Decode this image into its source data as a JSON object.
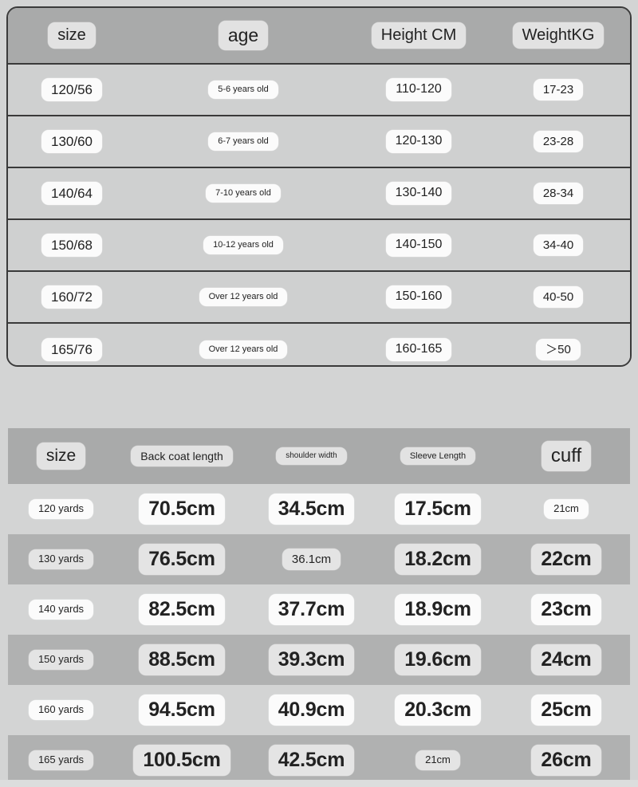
{
  "colors": {
    "page_background": "#d3d4d4",
    "header_bar": "#a9aaaa",
    "table_one_body": "#cfd0d0",
    "table_one_border": "#3a3a3a",
    "stripe_row": "#b0b1b1",
    "chip_light": "#fbfbfb",
    "chip_header": "#e2e2e2",
    "text": "#1e1e1e"
  },
  "size_table": {
    "headers": [
      "size",
      "age",
      "Height CM",
      "WeightKG"
    ],
    "rows": [
      {
        "size": "120/56",
        "age": "5-6 years old",
        "height": "110-120",
        "weight": "17-23"
      },
      {
        "size": "130/60",
        "age": "6-7 years old",
        "height": "120-130",
        "weight": "23-28"
      },
      {
        "size": "140/64",
        "age": "7-10 years old",
        "height": "130-140",
        "weight": "28-34"
      },
      {
        "size": "150/68",
        "age": "10-12 years old",
        "height": "140-150",
        "weight": "34-40"
      },
      {
        "size": "160/72",
        "age": "Over 12 years old",
        "height": "150-160",
        "weight": "40-50"
      },
      {
        "size": "165/76",
        "age": "Over 12 years old",
        "height": "160-165",
        "weight": "＞50"
      }
    ]
  },
  "measurement_table": {
    "headers": [
      "size",
      "Back coat length",
      "shoulder width",
      "Sleeve Length",
      "cuff"
    ],
    "rows": [
      {
        "size": "120 yards",
        "back": "70.5cm",
        "shoulder": "34.5cm",
        "sleeve": "17.5cm",
        "cuff": "21cm"
      },
      {
        "size": "130 yards",
        "back": "76.5cm",
        "shoulder": "36.1cm",
        "sleeve": "18.2cm",
        "cuff": "22cm"
      },
      {
        "size": "140 yards",
        "back": "82.5cm",
        "shoulder": "37.7cm",
        "sleeve": "18.9cm",
        "cuff": "23cm"
      },
      {
        "size": "150 yards",
        "back": "88.5cm",
        "shoulder": "39.3cm",
        "sleeve": "19.6cm",
        "cuff": "24cm"
      },
      {
        "size": "160 yards",
        "back": "94.5cm",
        "shoulder": "40.9cm",
        "sleeve": "20.3cm",
        "cuff": "25cm"
      },
      {
        "size": "165 yards",
        "back": "100.5cm",
        "shoulder": "42.5cm",
        "sleeve": "21cm",
        "cuff": "26cm"
      }
    ]
  }
}
